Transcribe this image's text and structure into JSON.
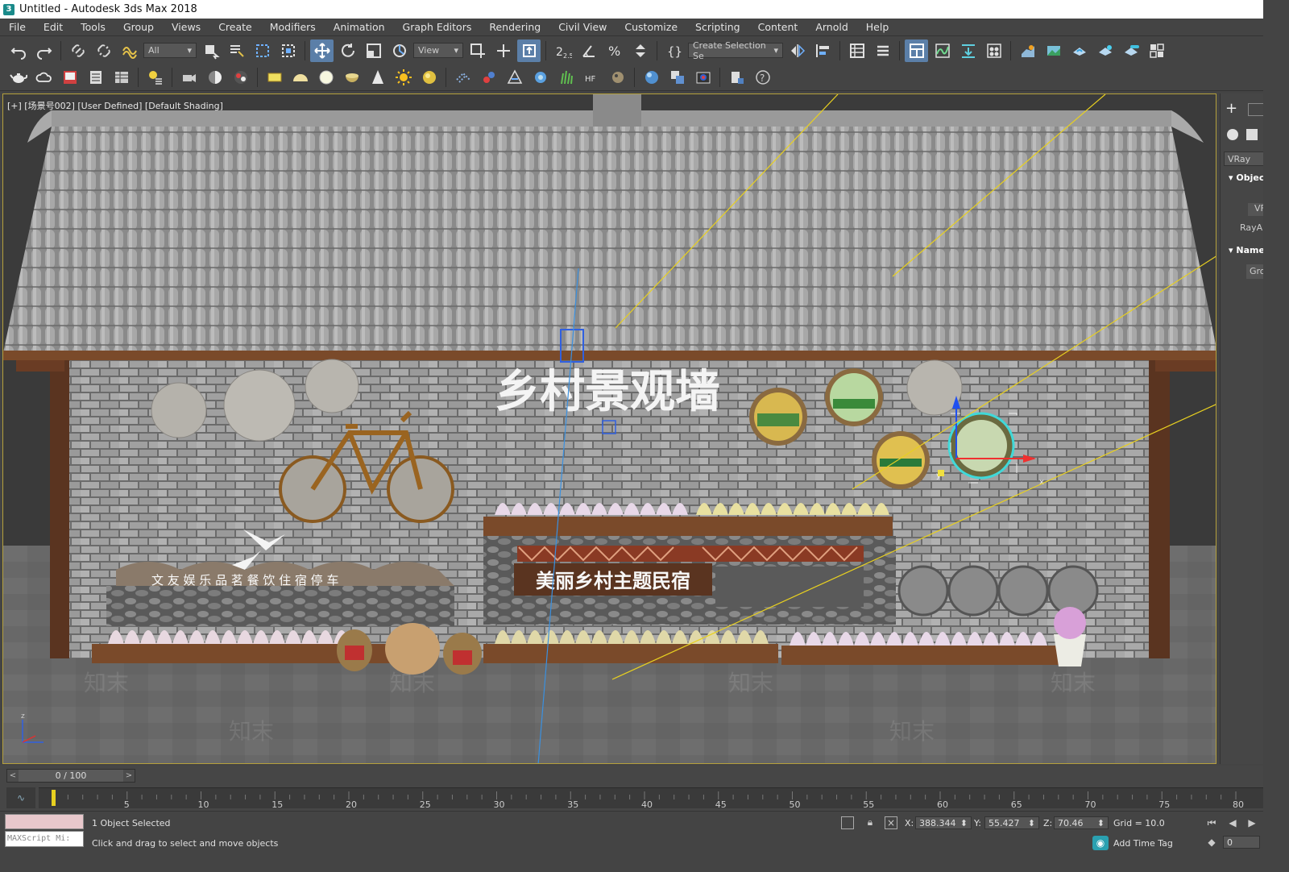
{
  "window": {
    "title": "Untitled - Autodesk 3ds Max 2018",
    "app_icon": "3"
  },
  "menu": [
    "File",
    "Edit",
    "Tools",
    "Group",
    "Views",
    "Create",
    "Modifiers",
    "Animation",
    "Graph Editors",
    "Rendering",
    "Civil View",
    "Customize",
    "Scripting",
    "Content",
    "Arnold",
    "Help"
  ],
  "toolbar": {
    "selection_filter": "All",
    "ref_coord": "View",
    "named_selection_placeholder": "Create Selection Se",
    "snap_angle_label": "2.5",
    "icons_row1": [
      "undo-icon",
      "redo-icon",
      "link-icon",
      "unlink-icon",
      "bind-space-warp-icon",
      "select-object-icon",
      "select-by-name-icon",
      "rectangle-selection-icon",
      "window-crossing-icon",
      "select-move-icon",
      "select-rotate-icon",
      "select-scale-icon",
      "select-place-icon",
      "use-pivot-icon",
      "select-manipulate-icon",
      "keyboard-shortcut-icon",
      "snaps-toggle-icon",
      "angle-snap-icon",
      "percent-snap-icon",
      "spinner-snap-icon",
      "edit-named-selection-icon",
      "mirror-icon",
      "align-icon",
      "layer-explorer-icon",
      "scene-explorer-icon",
      "toggle-ribbon-icon",
      "curve-editor-icon",
      "schematic-view-icon",
      "material-editor-icon",
      "render-setup-icon",
      "rendered-frame-icon",
      "render-production-icon",
      "render-iterative-icon",
      "render-cloud-icon",
      "vray-frame-buffer-icon"
    ],
    "icons_row2": [
      "teapot-icon",
      "cloud-icon",
      "render-frame-icon",
      "layers-icon",
      "table-icon",
      "light-lister-icon",
      "camera-icon",
      "sphere-half-icon",
      "vray-render-icon",
      "vray-plane-icon",
      "vray-dome-icon",
      "vray-sphere-icon",
      "vray-bowl-icon",
      "vray-cone-icon",
      "vray-sun-icon",
      "vray-ball-icon",
      "vray-proxy-icon",
      "vray-fur-icon",
      "vray-scatter-icon",
      "vray-decal-icon",
      "vray-grass-icon",
      "vray-hair-icon",
      "vray-ball2-icon",
      "vray-material-icon",
      "vray-converter-icon",
      "vray-vfb-icon",
      "vray-clip-icon",
      "help-icon"
    ]
  },
  "viewport": {
    "label": "[+] [场景号002] [User Defined] [Default Shading]",
    "sign_title": "乡村景观墙",
    "sign_subtitle": "美丽乡村主题民宿",
    "fence_text": "文 友   娱 乐   品 茗     餐 饮   住 宿   停 车",
    "axis_x": "x",
    "axis_y": "y",
    "axis_z": "z",
    "watermark": "知末",
    "border_color": "#b5a03c"
  },
  "command_panel": {
    "renderer": "VRay",
    "rollout_object": "Objec",
    "btn_vr": "VF",
    "btn_ray": "RayA",
    "rollout_name": "Name",
    "name_value": "Gro"
  },
  "timeline": {
    "frame_display": "0 / 100",
    "prev": "<",
    "next": ">",
    "ticks": [
      "5",
      "10",
      "15",
      "20",
      "25",
      "30",
      "35",
      "40",
      "45",
      "50",
      "55",
      "60",
      "65",
      "70",
      "75",
      "80"
    ]
  },
  "status": {
    "selected": "1 Object Selected",
    "prompt": "Click and drag to select and move objects",
    "maxscript": "MAXScript Mi:",
    "x_label": "X:",
    "x_value": "388.344",
    "y_label": "Y:",
    "y_value": "55.427",
    "z_label": "Z:",
    "z_value": "70.46",
    "grid": "Grid = 10.0",
    "add_time_tag": "Add Time Tag",
    "frame_field": "0"
  }
}
